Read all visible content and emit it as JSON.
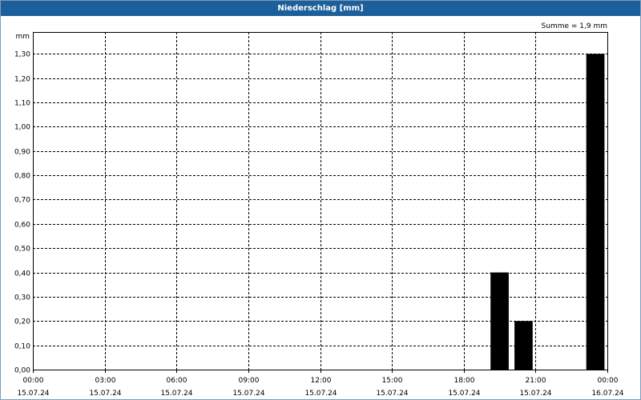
{
  "window": {
    "title": "Niederschlag [mm]"
  },
  "summary": "Summe = 1,9 mm",
  "colors": {
    "titlebar": "#1d5f9a",
    "bars": "#000000",
    "grid": "#000000"
  },
  "chart_data": {
    "type": "bar",
    "title": "Niederschlag [mm]",
    "ylabel": "mm",
    "xlabel": "",
    "ylim": [
      0,
      1.3
    ],
    "yticks": [
      "0,00",
      "0,10",
      "0,20",
      "0,30",
      "0,40",
      "0,50",
      "0,60",
      "0,70",
      "0,80",
      "0,90",
      "1,00",
      "1,10",
      "1,20",
      "1,30"
    ],
    "xlim": [
      "15.07.24 00:00",
      "16.07.24 00:00"
    ],
    "xticks": [
      {
        "time": "00:00",
        "date": "15.07.24"
      },
      {
        "time": "03:00",
        "date": "15.07.24"
      },
      {
        "time": "06:00",
        "date": "15.07.24"
      },
      {
        "time": "09:00",
        "date": "15.07.24"
      },
      {
        "time": "12:00",
        "date": "15.07.24"
      },
      {
        "time": "15:00",
        "date": "15.07.24"
      },
      {
        "time": "18:00",
        "date": "15.07.24"
      },
      {
        "time": "21:00",
        "date": "15.07.24"
      },
      {
        "time": "00:00",
        "date": "16.07.24"
      }
    ],
    "grid": true,
    "bars": [
      {
        "start": "15.07.24 19:00",
        "end": "15.07.24 20:00",
        "value": 0.4
      },
      {
        "start": "15.07.24 20:00",
        "end": "15.07.24 21:00",
        "value": 0.2
      },
      {
        "start": "15.07.24 23:00",
        "end": "16.07.24 00:00",
        "value": 1.3
      }
    ],
    "total": "Summe = 1,9 mm"
  }
}
